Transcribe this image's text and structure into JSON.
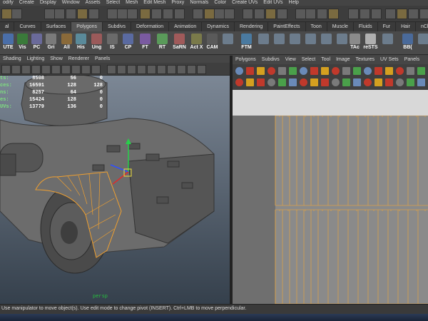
{
  "menubar": [
    "odify",
    "Create",
    "Display",
    "Window",
    "Assets",
    "Select",
    "Mesh",
    "Edit Mesh",
    "Proxy",
    "Normals",
    "Color",
    "Create UVs",
    "Edit UVs",
    "Help"
  ],
  "shelf_tabs": [
    "al",
    "Curves",
    "Surfaces",
    "Polygons",
    "Subdivs",
    "Deformation",
    "Animation",
    "Dynamics",
    "Rendering",
    "PaintEffects",
    "Toon",
    "Muscle",
    "Fluids",
    "Fur",
    "Hair",
    "nCl"
  ],
  "shelf_buttons": [
    "UTE",
    "Vis",
    "PC",
    "Gri",
    "All",
    "His",
    "Ung",
    "IS",
    "CP",
    "FT",
    "RT",
    "SaRN",
    "Act X",
    "CAM",
    "FTM",
    "TAc",
    "reSTS",
    "BB("
  ],
  "viewport": {
    "menu": [
      "Shading",
      "Lighting",
      "Show",
      "Renderer",
      "Panels"
    ],
    "hud_labels": [
      "ts:",
      "ces:",
      "ns:",
      "es:",
      "UVs:"
    ],
    "hud_rows": [
      [
        "8508",
        "56",
        "0"
      ],
      [
        "16591",
        "128",
        "128"
      ],
      [
        "8257",
        "64",
        "0"
      ],
      [
        "15424",
        "128",
        "0"
      ],
      [
        "13779",
        "136",
        "0"
      ]
    ],
    "axis_label": "persp"
  },
  "uv_editor": {
    "menu": [
      "Polygons",
      "Subdivs",
      "View",
      "Select",
      "Tool",
      "Image",
      "Textures",
      "UV Sets",
      "Panels"
    ]
  },
  "helpline": "Use manipulator to move object(s). Use edit mode to change pivot (INSERT). Ctrl+LMB to move perpendicular.",
  "colors": {
    "uv_line": "#d9a14a",
    "selection": "#f0a030",
    "grid_bg": "#8a8a8a"
  }
}
